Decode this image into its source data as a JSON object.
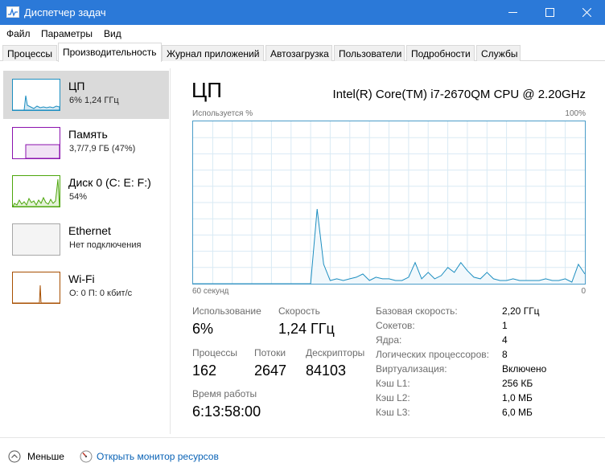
{
  "window": {
    "title": "Диспетчер задач"
  },
  "menu": [
    "Файл",
    "Параметры",
    "Вид"
  ],
  "tabs": [
    {
      "label": "Процессы"
    },
    {
      "label": "Производительность"
    },
    {
      "label": "Журнал приложений"
    },
    {
      "label": "Автозагрузка"
    },
    {
      "label": "Пользователи"
    },
    {
      "label": "Подробности"
    },
    {
      "label": "Службы"
    }
  ],
  "active_tab": "Производительность",
  "sidebar": [
    {
      "name": "ЦП",
      "sub": "6%  1,24 ГГц",
      "color": "#1d8ec0"
    },
    {
      "name": "Память",
      "sub": "3,7/7,9 ГБ (47%)",
      "color": "#8b12ae"
    },
    {
      "name": "Диск 0 (C: E: F:)",
      "sub": "54%",
      "color": "#4da60c"
    },
    {
      "name": "Ethernet",
      "sub": "Нет подключения",
      "color": "#a7a7a7"
    },
    {
      "name": "Wi-Fi",
      "sub": "О: 0 П: 0 кбит/с",
      "color": "#a74f01"
    }
  ],
  "selected_item": "ЦП",
  "main": {
    "title": "ЦП",
    "cpu_model": "Intel(R) Core(TM) i7-2670QM CPU @ 2.20GHz",
    "graph_top_label": "Используется %",
    "graph_max_label": "100%",
    "graph_left_bottom": "60 секунд",
    "graph_right_bottom": "0"
  },
  "stats": {
    "usage_label": "Использование",
    "usage_value": "6%",
    "speed_label": "Скорость",
    "speed_value": "1,24 ГГц",
    "processes_label": "Процессы",
    "processes_value": "162",
    "threads_label": "Потоки",
    "threads_value": "2647",
    "handles_label": "Дескрипторы",
    "handles_value": "84103",
    "uptime_label": "Время работы",
    "uptime_value": "6:13:58:00"
  },
  "details": [
    {
      "key": "Базовая скорость:",
      "value": "2,20 ГГц"
    },
    {
      "key": "Сокетов:",
      "value": "1"
    },
    {
      "key": "Ядра:",
      "value": "4"
    },
    {
      "key": "Логических процессоров:",
      "value": "8"
    },
    {
      "key": "Виртуализация:",
      "value": "Включено"
    },
    {
      "key": "Кэш L1:",
      "value": "256 КБ"
    },
    {
      "key": "Кэш L2:",
      "value": "1,0 МБ"
    },
    {
      "key": "Кэш L3:",
      "value": "6,0 МБ"
    }
  ],
  "footer": {
    "less": "Меньше",
    "monitor": "Открыть монитор ресурсов"
  },
  "chart_data": {
    "type": "line",
    "ylabel": "Используется %",
    "ylim": [
      0,
      100
    ],
    "xlim": [
      60,
      0
    ],
    "grid": true,
    "x": [
      60,
      59,
      58,
      57,
      56,
      55,
      54,
      53,
      52,
      51,
      50,
      49,
      48,
      47,
      46,
      45,
      44,
      43,
      42,
      41,
      40,
      39,
      38,
      37,
      36,
      35,
      34,
      33,
      32,
      31,
      30,
      29,
      28,
      27,
      26,
      25,
      24,
      23,
      22,
      21,
      20,
      19,
      18,
      17,
      16,
      15,
      14,
      13,
      12,
      11,
      10,
      9,
      8,
      7,
      6,
      5,
      4,
      3,
      2,
      1,
      0
    ],
    "series": [
      {
        "color": "#1d8ec0",
        "values": [
          0,
          0,
          0,
          0,
          0,
          0,
          0,
          0,
          0,
          0,
          0,
          0,
          0,
          0,
          0,
          0,
          0,
          0,
          0,
          46,
          12,
          2,
          3,
          2,
          3,
          4,
          6,
          2,
          4,
          3,
          3,
          2,
          2,
          4,
          13,
          3,
          7,
          3,
          5,
          10,
          7,
          13,
          8,
          4,
          3,
          7,
          3,
          2,
          2,
          3,
          2,
          2,
          2,
          2,
          3,
          2,
          2,
          3,
          1,
          12,
          6
        ]
      }
    ]
  }
}
